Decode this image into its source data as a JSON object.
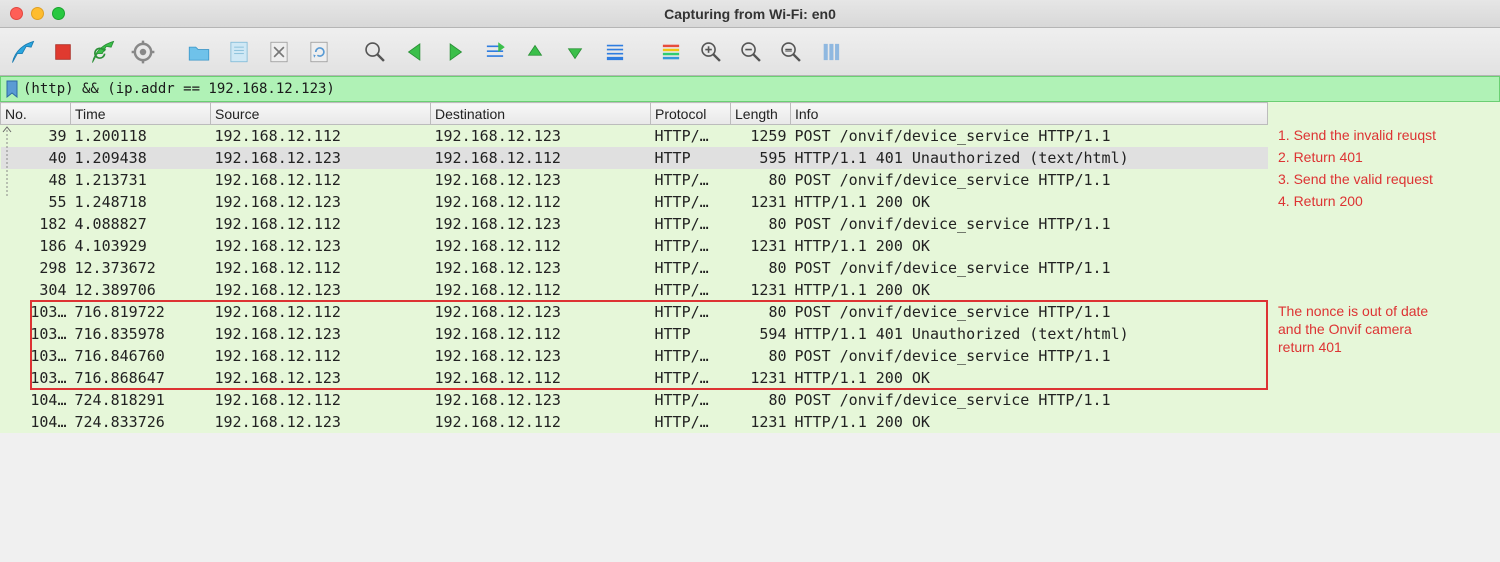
{
  "window": {
    "title": "Capturing from Wi-Fi: en0"
  },
  "filter": {
    "expression": "(http) && (ip.addr == 192.168.12.123)"
  },
  "columns": {
    "no": "No.",
    "time": "Time",
    "source": "Source",
    "destination": "Destination",
    "protocol": "Protocol",
    "length": "Length",
    "info": "Info"
  },
  "rows": [
    {
      "no": "39",
      "time": "1.200118",
      "src": "192.168.12.112",
      "dst": "192.168.12.123",
      "proto": "HTTP/…",
      "len": "1259",
      "info": "POST /onvif/device_service HTTP/1.1",
      "sel": false
    },
    {
      "no": "40",
      "time": "1.209438",
      "src": "192.168.12.123",
      "dst": "192.168.12.112",
      "proto": "HTTP",
      "len": "595",
      "info": "HTTP/1.1 401 Unauthorized  (text/html)",
      "sel": true
    },
    {
      "no": "48",
      "time": "1.213731",
      "src": "192.168.12.112",
      "dst": "192.168.12.123",
      "proto": "HTTP/…",
      "len": "80",
      "info": "POST /onvif/device_service HTTP/1.1",
      "sel": false
    },
    {
      "no": "55",
      "time": "1.248718",
      "src": "192.168.12.123",
      "dst": "192.168.12.112",
      "proto": "HTTP/…",
      "len": "1231",
      "info": "HTTP/1.1 200 OK",
      "sel": false
    },
    {
      "no": "182",
      "time": "4.088827",
      "src": "192.168.12.112",
      "dst": "192.168.12.123",
      "proto": "HTTP/…",
      "len": "80",
      "info": "POST /onvif/device_service HTTP/1.1",
      "sel": false
    },
    {
      "no": "186",
      "time": "4.103929",
      "src": "192.168.12.123",
      "dst": "192.168.12.112",
      "proto": "HTTP/…",
      "len": "1231",
      "info": "HTTP/1.1 200 OK",
      "sel": false
    },
    {
      "no": "298",
      "time": "12.373672",
      "src": "192.168.12.112",
      "dst": "192.168.12.123",
      "proto": "HTTP/…",
      "len": "80",
      "info": "POST /onvif/device_service HTTP/1.1",
      "sel": false
    },
    {
      "no": "304",
      "time": "12.389706",
      "src": "192.168.12.123",
      "dst": "192.168.12.112",
      "proto": "HTTP/…",
      "len": "1231",
      "info": "HTTP/1.1 200 OK",
      "sel": false
    },
    {
      "no": "103…",
      "time": "716.819722",
      "src": "192.168.12.112",
      "dst": "192.168.12.123",
      "proto": "HTTP/…",
      "len": "80",
      "info": "POST /onvif/device_service HTTP/1.1",
      "sel": false
    },
    {
      "no": "103…",
      "time": "716.835978",
      "src": "192.168.12.123",
      "dst": "192.168.12.112",
      "proto": "HTTP",
      "len": "594",
      "info": "HTTP/1.1 401 Unauthorized  (text/html)",
      "sel": false
    },
    {
      "no": "103…",
      "time": "716.846760",
      "src": "192.168.12.112",
      "dst": "192.168.12.123",
      "proto": "HTTP/…",
      "len": "80",
      "info": "POST /onvif/device_service HTTP/1.1",
      "sel": false
    },
    {
      "no": "103…",
      "time": "716.868647",
      "src": "192.168.12.123",
      "dst": "192.168.12.112",
      "proto": "HTTP/…",
      "len": "1231",
      "info": "HTTP/1.1 200 OK",
      "sel": false
    },
    {
      "no": "104…",
      "time": "724.818291",
      "src": "192.168.12.112",
      "dst": "192.168.12.123",
      "proto": "HTTP/…",
      "len": "80",
      "info": "POST /onvif/device_service HTTP/1.1",
      "sel": false
    },
    {
      "no": "104…",
      "time": "724.833726",
      "src": "192.168.12.123",
      "dst": "192.168.12.112",
      "proto": "HTTP/…",
      "len": "1231",
      "info": "HTTP/1.1 200 OK",
      "sel": false
    }
  ],
  "annotations": {
    "a1": "1. Send the invalid reuqst",
    "a2": "2. Return 401",
    "a3": "3. Send the valid request",
    "a4": "4. Return 200",
    "box_note_l1": "The nonce is out of date",
    "box_note_l2": "and the Onvif camera",
    "box_note_l3": "return 401"
  }
}
